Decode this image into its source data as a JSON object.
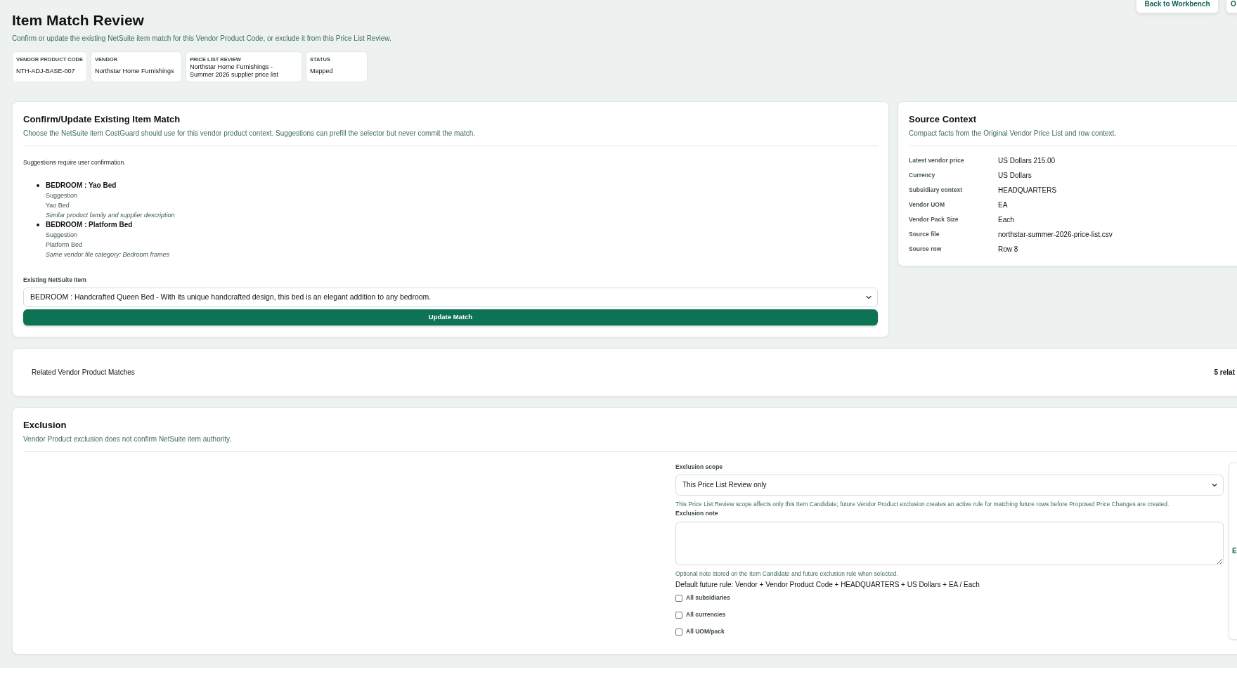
{
  "header": {
    "title": "Item Match Review",
    "subtitle": "Confirm or update the existing NetSuite item match for this Vendor Product Code, or exclude it from this Price List Review.",
    "actions": [
      {
        "label": "Back to Workbench"
      },
      {
        "label": "O"
      }
    ]
  },
  "facts": [
    {
      "label": "VENDOR PRODUCT CODE",
      "value": "NTH-ADJ-BASE-007"
    },
    {
      "label": "VENDOR",
      "value": "Northstar Home Furnishings"
    },
    {
      "label": "PRICE LIST REVIEW",
      "value": "Northstar Home Furnishings - Summer 2026 supplier price list"
    },
    {
      "label": "STATUS",
      "value": "Mapped"
    }
  ],
  "match_panel": {
    "title": "Confirm/Update Existing Item Match",
    "description": "Choose the NetSuite item CostGuard should use for this vendor product context. Suggestions can prefill the selector but never commit the match.",
    "note": "Suggestions require user confirmation.",
    "suggestions": [
      {
        "name": "BEDROOM : Yao Bed",
        "type": "Suggestion",
        "item": "Yao Bed",
        "reason": "Similar product family and supplier description"
      },
      {
        "name": "BEDROOM : Platform Bed",
        "type": "Suggestion",
        "item": "Platform Bed",
        "reason": "Same vendor file category: Bedroom frames"
      }
    ],
    "field_label": "Existing NetSuite Item",
    "selected_item": "BEDROOM : Handcrafted Queen Bed - With its unique handcrafted design, this bed is an elegant addition to any bedroom.",
    "button": "Update Match"
  },
  "source_context": {
    "title": "Source Context",
    "description": "Compact facts from the Original Vendor Price List and row context.",
    "rows": [
      {
        "label": "Latest vendor price",
        "value": "US Dollars 215.00"
      },
      {
        "label": "Currency",
        "value": "US Dollars"
      },
      {
        "label": "Subsidiary context",
        "value": "HEADQUARTERS"
      },
      {
        "label": "Vendor UOM",
        "value": "EA"
      },
      {
        "label": "Vendor Pack Size",
        "value": "Each"
      },
      {
        "label": "Source file",
        "value": "northstar-summer-2026-price-list.csv"
      },
      {
        "label": "Source row",
        "value": "Row 8"
      }
    ]
  },
  "related": {
    "title": "Related Vendor Product Matches",
    "count": "5 relat"
  },
  "exclusion": {
    "title": "Exclusion",
    "description": "Vendor Product exclusion does not confirm NetSuite item authority.",
    "scope_label": "Exclusion scope",
    "scope_value": "This Price List Review only",
    "scope_help": "This Price List Review scope affects only this Item Candidate; future Vendor Product exclusion creates an active rule for matching future rows before Proposed Price Changes are created.",
    "note_label": "Exclusion note",
    "note_help": "Optional note stored on the Item Candidate and future exclusion rule when selected.",
    "default_rule": "Default future rule: Vendor + Vendor Product Code + HEADQUARTERS + US Dollars + EA / Each",
    "options": [
      {
        "label": "All subsidiaries",
        "checked": false
      },
      {
        "label": "All currencies",
        "checked": false
      },
      {
        "label": "All UOM/pack",
        "checked": false
      }
    ],
    "side_panel_label": "E"
  }
}
